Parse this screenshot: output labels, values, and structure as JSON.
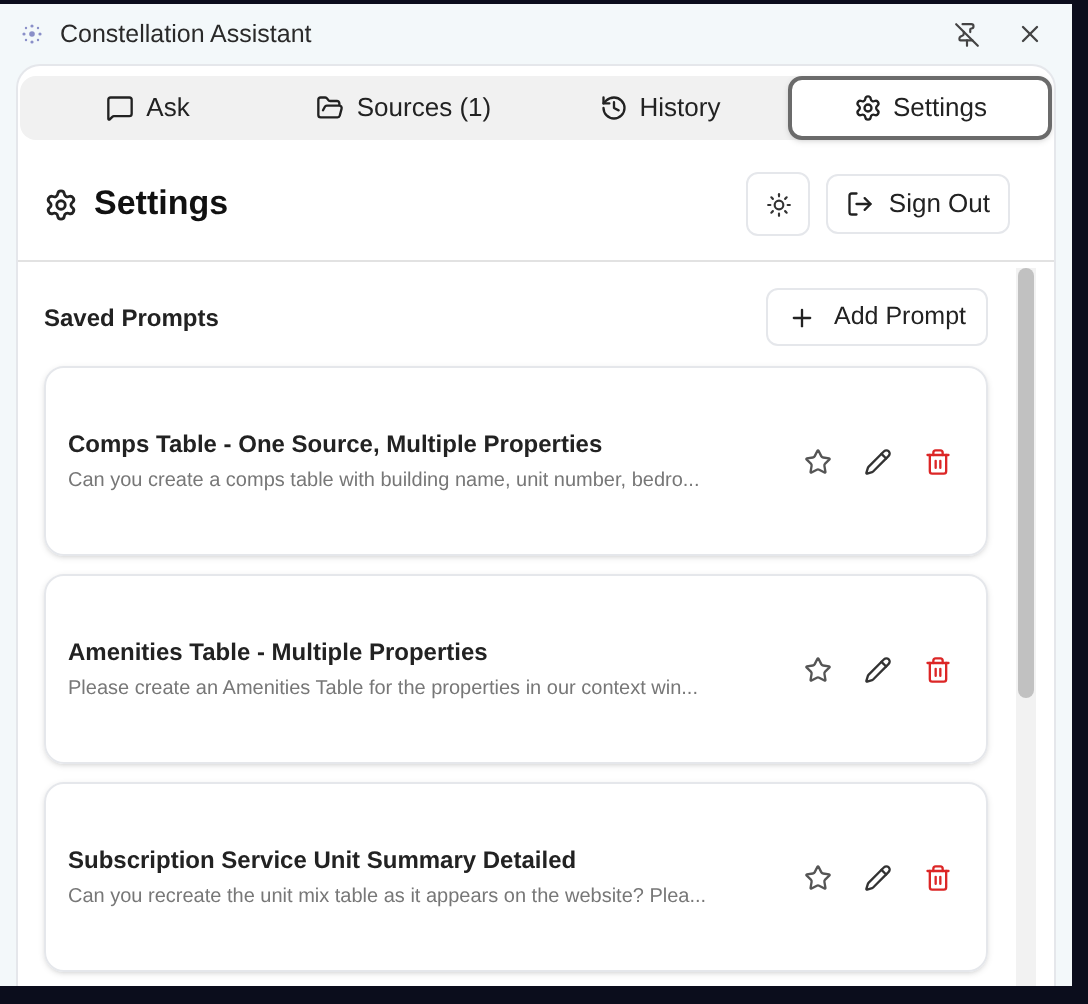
{
  "window": {
    "title": "Constellation Assistant"
  },
  "tabs": [
    {
      "label": "Ask",
      "selected": false
    },
    {
      "label": "Sources (1)",
      "selected": false
    },
    {
      "label": "History",
      "selected": false
    },
    {
      "label": "Settings",
      "selected": true
    }
  ],
  "header": {
    "title": "Settings",
    "sign_out": "Sign Out"
  },
  "saved_prompts": {
    "title": "Saved Prompts",
    "add_button": "Add Prompt",
    "prompts": [
      {
        "title": "Comps Table - One Source, Multiple Properties",
        "description": "Can you create a comps table with building name, unit number, bedro..."
      },
      {
        "title": "Amenities Table - Multiple Properties",
        "description": "Please create an Amenities Table for the properties in our context win..."
      },
      {
        "title": "Subscription Service Unit Summary Detailed",
        "description": "Can you recreate the unit mix table as it appears on the website? Plea..."
      }
    ]
  }
}
